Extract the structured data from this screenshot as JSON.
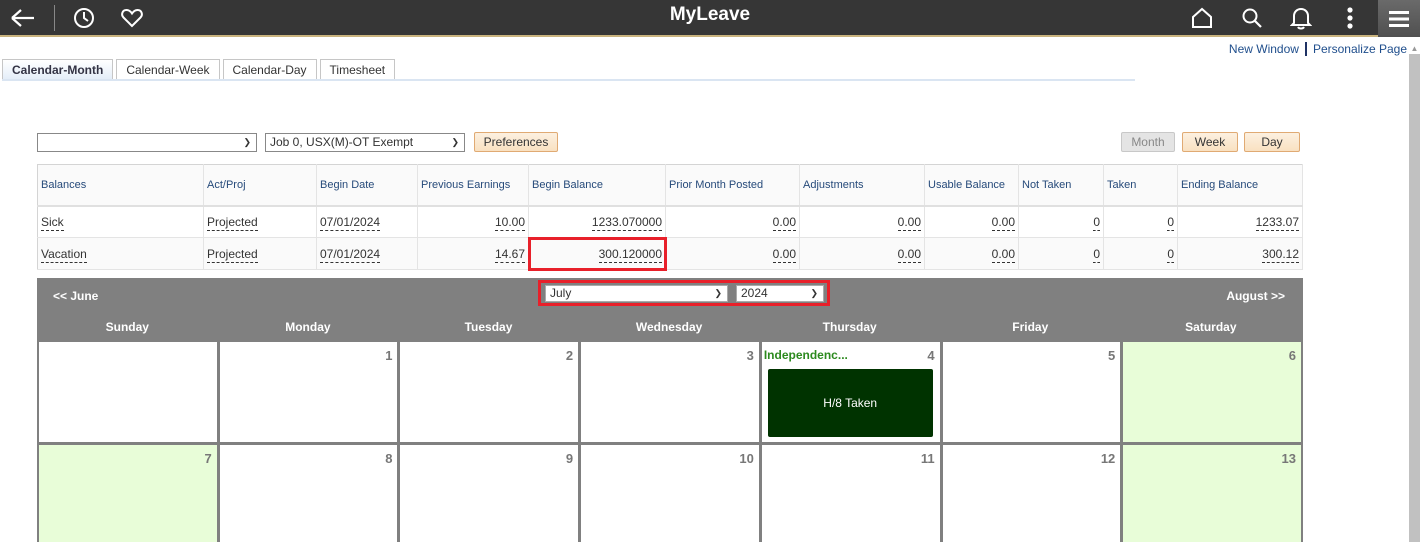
{
  "header": {
    "title": "MyLeave",
    "left_icons": [
      "back-arrow-icon",
      "recent-history-icon",
      "favorites-heart-icon"
    ],
    "right_icons": [
      "home-icon",
      "search-icon",
      "notifications-bell-icon",
      "more-actions-kebab-icon",
      "navbar-hamburger-icon"
    ]
  },
  "page_links": {
    "new_window": "New Window",
    "personalize": "Personalize Page"
  },
  "tabs": [
    {
      "label": "Calendar-Month",
      "active": true
    },
    {
      "label": "Calendar-Week",
      "active": false
    },
    {
      "label": "Calendar-Day",
      "active": false
    },
    {
      "label": "Timesheet",
      "active": false
    }
  ],
  "controls": {
    "first_select_value": "",
    "job_select_value": "Job 0, USX(M)-OT Exempt",
    "preferences_label": "Preferences",
    "view_buttons": {
      "month": "Month",
      "week": "Week",
      "day": "Day"
    },
    "active_view": "Month"
  },
  "balances": {
    "columns": [
      "Balances",
      "Act/Proj",
      "Begin Date",
      "Previous Earnings",
      "Begin Balance",
      "Prior Month Posted",
      "Adjustments",
      "Usable Balance",
      "Not Taken",
      "Taken",
      "Ending Balance"
    ],
    "rows": [
      [
        "Sick",
        "Projected",
        "07/01/2024",
        "10.00",
        "1233.070000",
        "0.00",
        "0.00",
        "0.00",
        "0",
        "0",
        "1233.07"
      ],
      [
        "Vacation",
        "Projected",
        "07/01/2024",
        "14.67",
        "300.120000",
        "0.00",
        "0.00",
        "0.00",
        "0",
        "0",
        "300.12"
      ]
    ],
    "highlighted_cell": {
      "row": 1,
      "column": "Begin Balance"
    }
  },
  "calendar": {
    "prev_label": "<< June",
    "next_label": "August >>",
    "month_value": "July",
    "year_value": "2024",
    "weekdays": [
      "Sunday",
      "Monday",
      "Tuesday",
      "Wednesday",
      "Thursday",
      "Friday",
      "Saturday"
    ],
    "weeks": [
      [
        {
          "day": "",
          "weekend": false
        },
        {
          "day": "1",
          "weekend": false
        },
        {
          "day": "2",
          "weekend": false
        },
        {
          "day": "3",
          "weekend": false
        },
        {
          "day": "4",
          "weekend": false,
          "holiday": "Independenc...",
          "event": "H/8 Taken"
        },
        {
          "day": "5",
          "weekend": false
        },
        {
          "day": "6",
          "weekend": true
        }
      ],
      [
        {
          "day": "7",
          "weekend": true
        },
        {
          "day": "8",
          "weekend": false
        },
        {
          "day": "9",
          "weekend": false
        },
        {
          "day": "10",
          "weekend": false
        },
        {
          "day": "11",
          "weekend": false
        },
        {
          "day": "12",
          "weekend": false
        },
        {
          "day": "13",
          "weekend": true
        }
      ]
    ]
  },
  "colors": {
    "header_bg": "#363636",
    "header_accent": "#c9b37e",
    "calendar_header_bg": "#808080",
    "weekend_bg": "#e8fdd8",
    "event_bg": "#003300",
    "holiday_text": "#2c8a1e",
    "highlight_border": "#e8202a"
  }
}
